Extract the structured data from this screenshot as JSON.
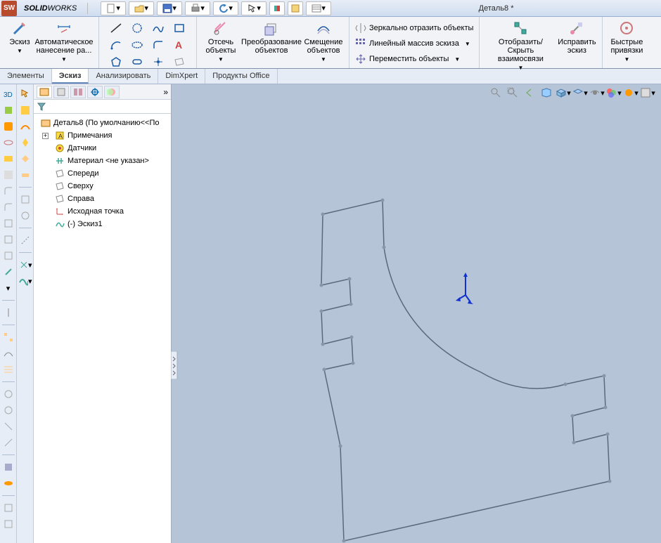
{
  "app": {
    "name_bold": "SOLID",
    "name_thin": "WORKS"
  },
  "document_title": "Деталь8 *",
  "ribbon": {
    "sketch_btn": "Эскиз",
    "smart_dim": "Автоматическое нанесение ра...",
    "trim": "Отсечь объекты",
    "convert": "Преобразование объектов",
    "offset": "Смещение объектов",
    "mirror": "Зеркально отразить объекты",
    "linear": "Линейный массив эскиза",
    "move": "Переместить объекты",
    "display": "Отобразить/Скрыть взаимосвязи",
    "repair": "Исправить эскиз",
    "snaps": "Быстрые привязки"
  },
  "tabs": [
    "Элементы",
    "Эскиз",
    "Анализировать",
    "DimXpert",
    "Продукты Office"
  ],
  "active_tab": 1,
  "tree": {
    "root": "Деталь8  (По умолчанию<<По",
    "items": [
      "Примечания",
      "Датчики",
      "Материал <не указан>",
      "Спереди",
      "Сверху",
      "Справа",
      "Исходная точка",
      "(-) Эскиз1"
    ]
  }
}
